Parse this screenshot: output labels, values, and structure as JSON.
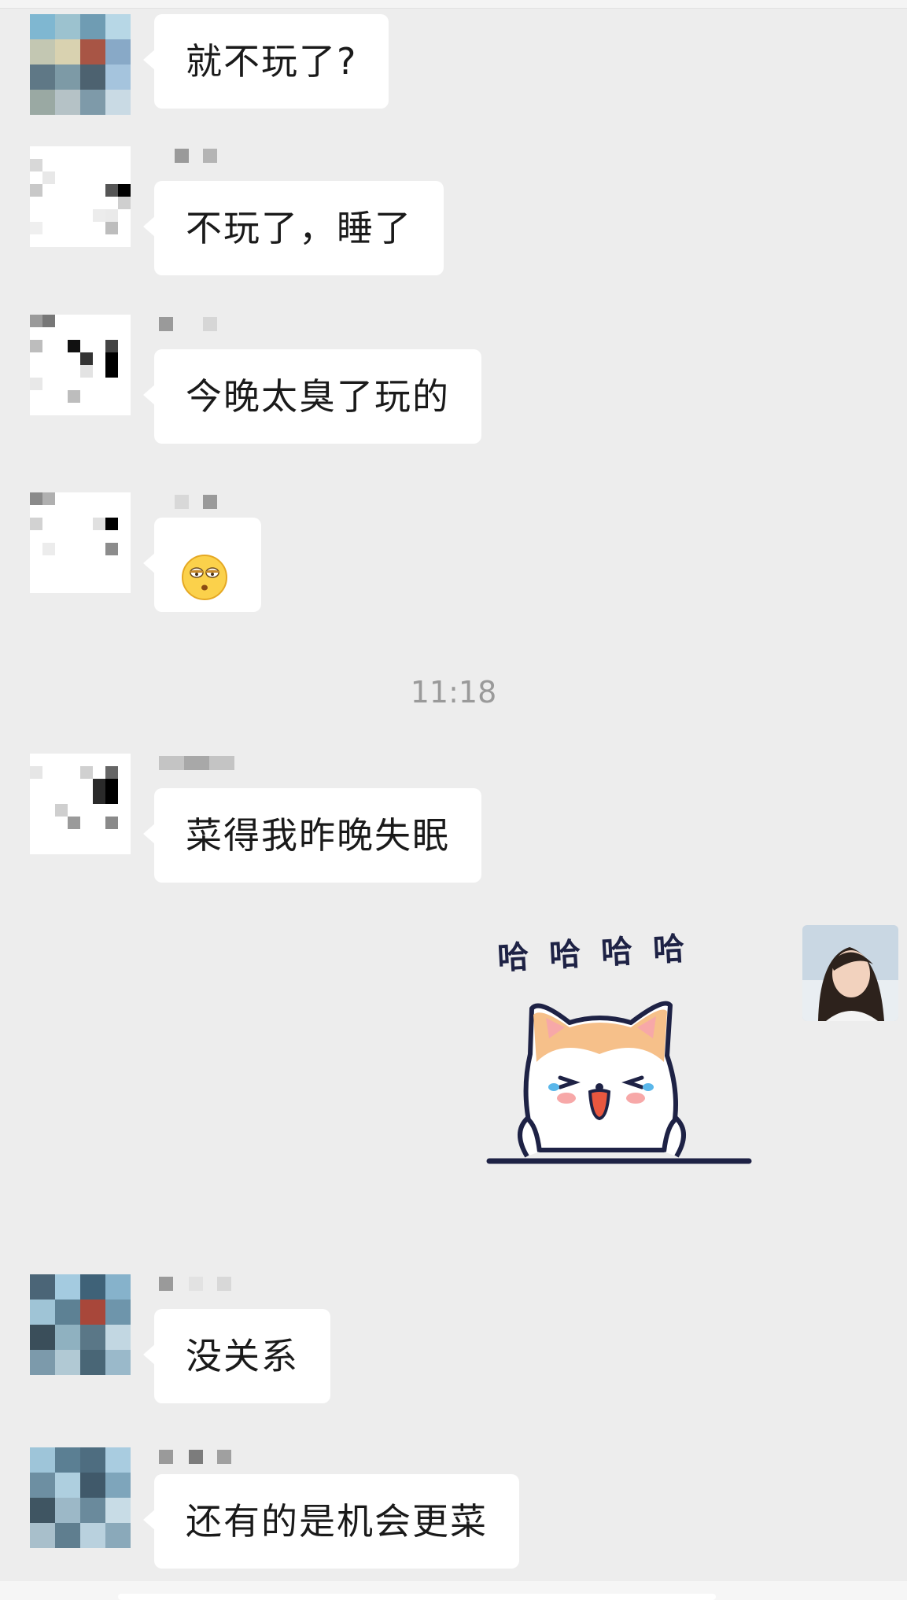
{
  "messages": [
    {
      "text": "就不玩了?"
    },
    {
      "text": "不玩了，睡了"
    },
    {
      "text": "今晚太臭了玩的"
    },
    {
      "emoji": "😳"
    },
    {
      "text": "菜得我昨晚失眠"
    },
    {
      "sticker": {
        "caption": "哈哈哈哈"
      }
    },
    {
      "text": "没关系"
    },
    {
      "text": "还有的是机会更菜"
    }
  ],
  "timestamp": "11:18",
  "colors": {
    "background": "#ededed",
    "bubble": "#ffffff",
    "timestamp": "#9a9a9a",
    "sticker_outline": "#1e2245",
    "sticker_fur": "#f6c08a"
  },
  "icons": {
    "emoji": "flushed-face-icon",
    "sticker": "laughing-corgi-sticker"
  }
}
